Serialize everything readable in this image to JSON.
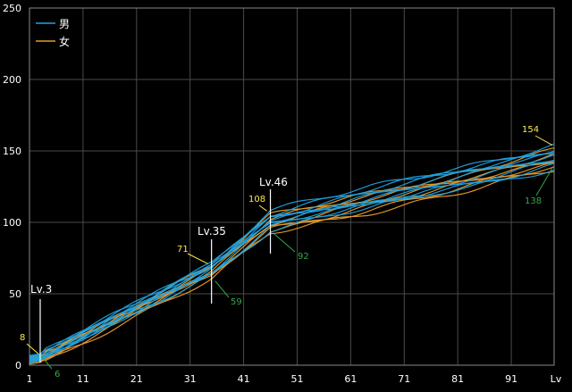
{
  "chart_data": {
    "type": "line",
    "xlabel": "Lv",
    "x_ticks": [
      1,
      11,
      21,
      31,
      41,
      51,
      61,
      71,
      81,
      91
    ],
    "y_ticks": [
      0,
      50,
      100,
      150,
      200,
      250
    ],
    "xlim": [
      1,
      99
    ],
    "ylim": [
      0,
      250
    ],
    "grid": true,
    "legend": {
      "position": "top-left",
      "entries": [
        {
          "label": "男",
          "color": "#1fa2e0"
        },
        {
          "label": "女",
          "color": "#e89a2a"
        }
      ]
    },
    "colors": {
      "male": "#1fa2e0",
      "female": "#e89a2a",
      "max_label": "#ffe94a",
      "min_label": "#33a84a",
      "background": "#000000",
      "grid": "#4a4a4a"
    },
    "series_pattern": {
      "male": {
        "count": 9,
        "start": [
          3,
          8
        ],
        "lv35": [
          64,
          72
        ],
        "lv46": [
          95,
          108
        ],
        "end": [
          138,
          154
        ]
      },
      "female": {
        "count": 7,
        "start": [
          2,
          7
        ],
        "lv35": [
          60,
          70
        ],
        "lv46": [
          92,
          104
        ],
        "end": [
          136,
          150
        ]
      }
    },
    "markers": [
      {
        "lv": 3,
        "label": "Lv.3"
      },
      {
        "lv": 35,
        "label": "Lv.35"
      },
      {
        "lv": 46,
        "label": "Lv.46"
      }
    ],
    "annotations": [
      {
        "lv": 3,
        "value": 8,
        "text": "8",
        "kind": "max"
      },
      {
        "lv": 3,
        "value": 6,
        "text": "6",
        "kind": "min"
      },
      {
        "lv": 35,
        "value": 71,
        "text": "71",
        "kind": "max"
      },
      {
        "lv": 35,
        "value": 59,
        "text": "59",
        "kind": "min"
      },
      {
        "lv": 46,
        "value": 108,
        "text": "108",
        "kind": "max"
      },
      {
        "lv": 46,
        "value": 92,
        "text": "92",
        "kind": "min"
      },
      {
        "lv": 99,
        "value": 154,
        "text": "154",
        "kind": "max"
      },
      {
        "lv": 99,
        "value": 138,
        "text": "138",
        "kind": "min"
      }
    ]
  }
}
